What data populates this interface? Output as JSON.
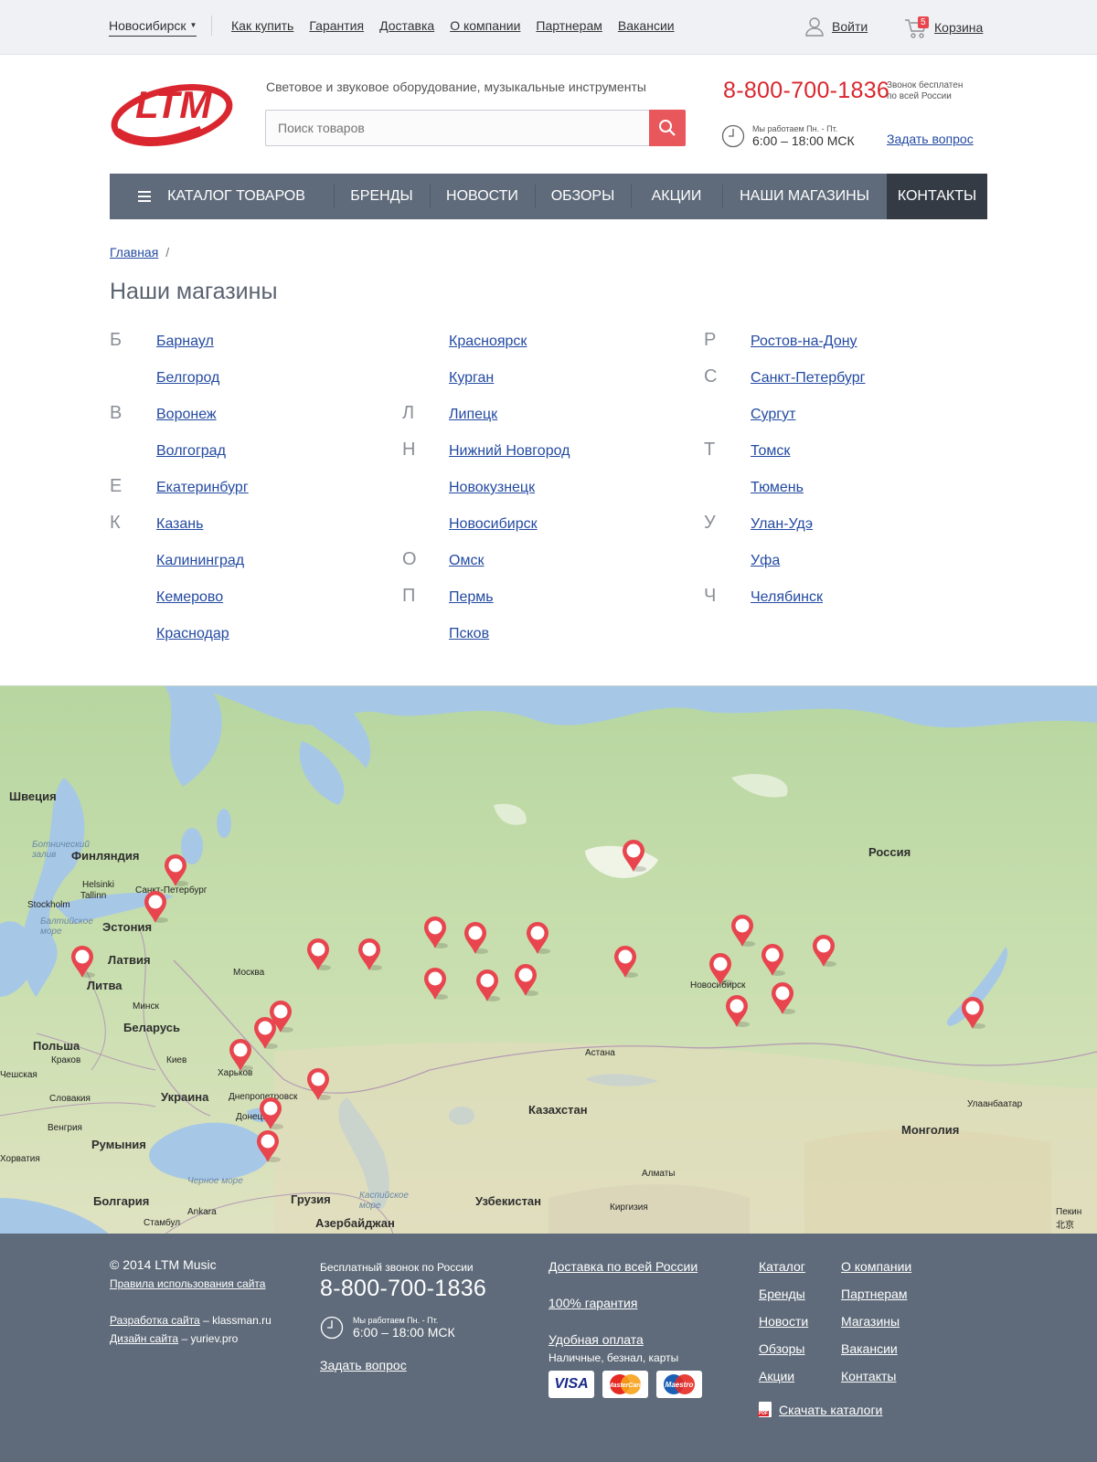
{
  "topbar": {
    "city": "Новосибирск",
    "nav": [
      "Как купить",
      "Гарантия",
      "Доставка",
      "О компании",
      "Партнерам",
      "Вакансии"
    ],
    "login": "Войти",
    "cart_label": "Корзина",
    "cart_count": "5"
  },
  "header": {
    "logo_text": "LTM",
    "tagline": "Световое и звуковое оборудование, музыкальные инструменты",
    "search_placeholder": "Поиск товаров",
    "phone": "8-800-700-1836",
    "phone_note_1": "Звонок бесплатен",
    "phone_note_2": "по всей России",
    "hours_label": "Мы работаем Пн. - Пт.",
    "hours": "6:00 – 18:00 МСК",
    "ask": "Задать вопрос"
  },
  "mainnav": [
    "Каталог товаров",
    "Бренды",
    "Новости",
    "Обзоры",
    "Акции",
    "Наши магазины",
    "Контакты"
  ],
  "breadcrumb": {
    "home": "Главная",
    "sep": "/"
  },
  "page_title": "Наши магазины",
  "stores": [
    [
      {
        "letter": "Б",
        "city": "Барнаул"
      },
      {
        "letter": "",
        "city": "Белгород"
      },
      {
        "letter": "В",
        "city": "Воронеж"
      },
      {
        "letter": "",
        "city": "Волгоград"
      },
      {
        "letter": "Е",
        "city": "Екатеринбург"
      },
      {
        "letter": "К",
        "city": "Казань"
      },
      {
        "letter": "",
        "city": "Калининград"
      },
      {
        "letter": "",
        "city": "Кемерово"
      },
      {
        "letter": "",
        "city": "Краснодар"
      }
    ],
    [
      {
        "letter": "",
        "city": "Красноярск"
      },
      {
        "letter": "",
        "city": "Курган"
      },
      {
        "letter": "Л",
        "city": "Липецк"
      },
      {
        "letter": "Н",
        "city": "Нижний Новгород"
      },
      {
        "letter": "",
        "city": "Новокузнецк"
      },
      {
        "letter": "",
        "city": "Новосибирск"
      },
      {
        "letter": "О",
        "city": "Омск"
      },
      {
        "letter": "П",
        "city": "Пермь"
      },
      {
        "letter": "",
        "city": "Псков"
      }
    ],
    [
      {
        "letter": "Р",
        "city": "Ростов-на-Дону"
      },
      {
        "letter": "С",
        "city": "Санкт-Петербург"
      },
      {
        "letter": "",
        "city": "Сургут"
      },
      {
        "letter": "Т",
        "city": "Томск"
      },
      {
        "letter": "",
        "city": "Тюмень"
      },
      {
        "letter": "У",
        "city": "Улан-Удэ"
      },
      {
        "letter": "",
        "city": "Уфа"
      },
      {
        "letter": "Ч",
        "city": "Челябинск"
      }
    ]
  ],
  "map": {
    "labels": {
      "sweden": "Швеция",
      "finland": "Финляндия",
      "bothnia": "Ботнический залив",
      "spb": "Санкт-Петербург",
      "tallinn": "Tallinn",
      "helsinki": "Helsinki",
      "stockholm": "Stockholm",
      "baltic": "Балтийское море",
      "estonia": "Эстония",
      "latvia": "Латвия",
      "lithuania": "Литва",
      "moscow": "Москва",
      "minsk": "Минск",
      "belarus": "Беларусь",
      "poland": "Польша",
      "krakow": "Краков",
      "kiev": "Киев",
      "kharkov": "Харьков",
      "ukraine": "Украина",
      "dnepr": "Днепропетровск",
      "donetsk": "Донецк",
      "czech": "Чешская",
      "slovakia": "Словакия",
      "hungary": "Венгрия",
      "romania": "Румыния",
      "croatia": "Хорватия",
      "bulgaria": "Болгария",
      "istanbul": "Стамбул",
      "ankara": "Ankara",
      "blacksea": "Черное море",
      "georgia": "Грузия",
      "azerbaijan": "Азербайджан",
      "caspian": "Каспийское море",
      "uzbekistan": "Узбекистан",
      "kyrgyzstan": "Киргизия",
      "almaty": "Алматы",
      "kazakhstan": "Казахстан",
      "astana": "Астана",
      "russia": "Россия",
      "novosibirsk": "Новосибирск",
      "mongolia": "Монголия",
      "ulaanbaatar": "Улаанбаатар",
      "beijing": "Пекин 北京"
    },
    "markers": [
      "Санкт-Петербург",
      "Псков",
      "Калининград",
      "Воронеж",
      "Белгород",
      "Липецк",
      "Нижний Новгород",
      "Краснодар",
      "Ростов-на-Дону",
      "Волгоград",
      "Казань",
      "Уфа",
      "Пермь",
      "Екатеринбург",
      "Челябинск",
      "Тюмень",
      "Курган",
      "Сургут",
      "Омск",
      "Новосибирск",
      "Томск",
      "Красноярск",
      "Кемерово",
      "Новокузнецк",
      "Барнаул",
      "Улан-Удэ"
    ]
  },
  "footer": {
    "copyright": "© 2014 LTM Music",
    "rules": "Правила использования сайта",
    "dev_link": "Разработка сайта",
    "dev_by": "– klassman.ru",
    "design_link": "Дизайн сайта",
    "design_by": "– yuriev.pro",
    "phone_label": "Бесплатный звонок по России",
    "phone": "8-800-700-1836",
    "hours_label": "Мы работаем Пн. - Пт.",
    "hours": "6:00 – 18:00 МСК",
    "ask": "Задать вопрос",
    "delivery": "Доставка по всей России",
    "guarantee": "100% гарантия",
    "payment": "Удобная оплата",
    "payment_note": "Наличные, безнал, карты",
    "cards": [
      "VISA",
      "MasterCard",
      "Maestro"
    ],
    "links_col1": [
      "Каталог",
      "Бренды",
      "Новости",
      "Обзоры",
      "Акции"
    ],
    "links_col2": [
      "О компании",
      "Партнерам",
      "Магазины",
      "Вакансии",
      "Контакты"
    ],
    "catalog_download": "Скачать каталоги",
    "pdf": "PDF"
  },
  "colors": {
    "accent_red": "#d9262f",
    "nav_bg": "#5f6b7a",
    "nav_active": "#343b44",
    "link": "#234aa1",
    "marker": "#e8454e"
  }
}
